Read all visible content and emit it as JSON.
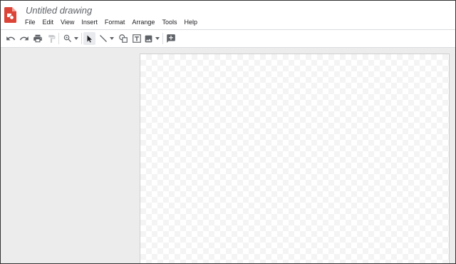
{
  "app": {
    "icon": "google-drawings-icon",
    "brand_color": "#db4437",
    "title": "Untitled drawing"
  },
  "menus": [
    "File",
    "Edit",
    "View",
    "Insert",
    "Format",
    "Arrange",
    "Tools",
    "Help"
  ],
  "toolbar": {
    "icons": [
      "undo-icon",
      "redo-icon",
      "print-icon",
      "paint-format-icon",
      "zoom-icon",
      "select-icon",
      "line-icon",
      "shape-icon",
      "text-box-icon",
      "image-icon",
      "add-comment-icon"
    ],
    "active_tool": "select"
  },
  "canvas": {
    "background": "transparent-checkerboard"
  }
}
